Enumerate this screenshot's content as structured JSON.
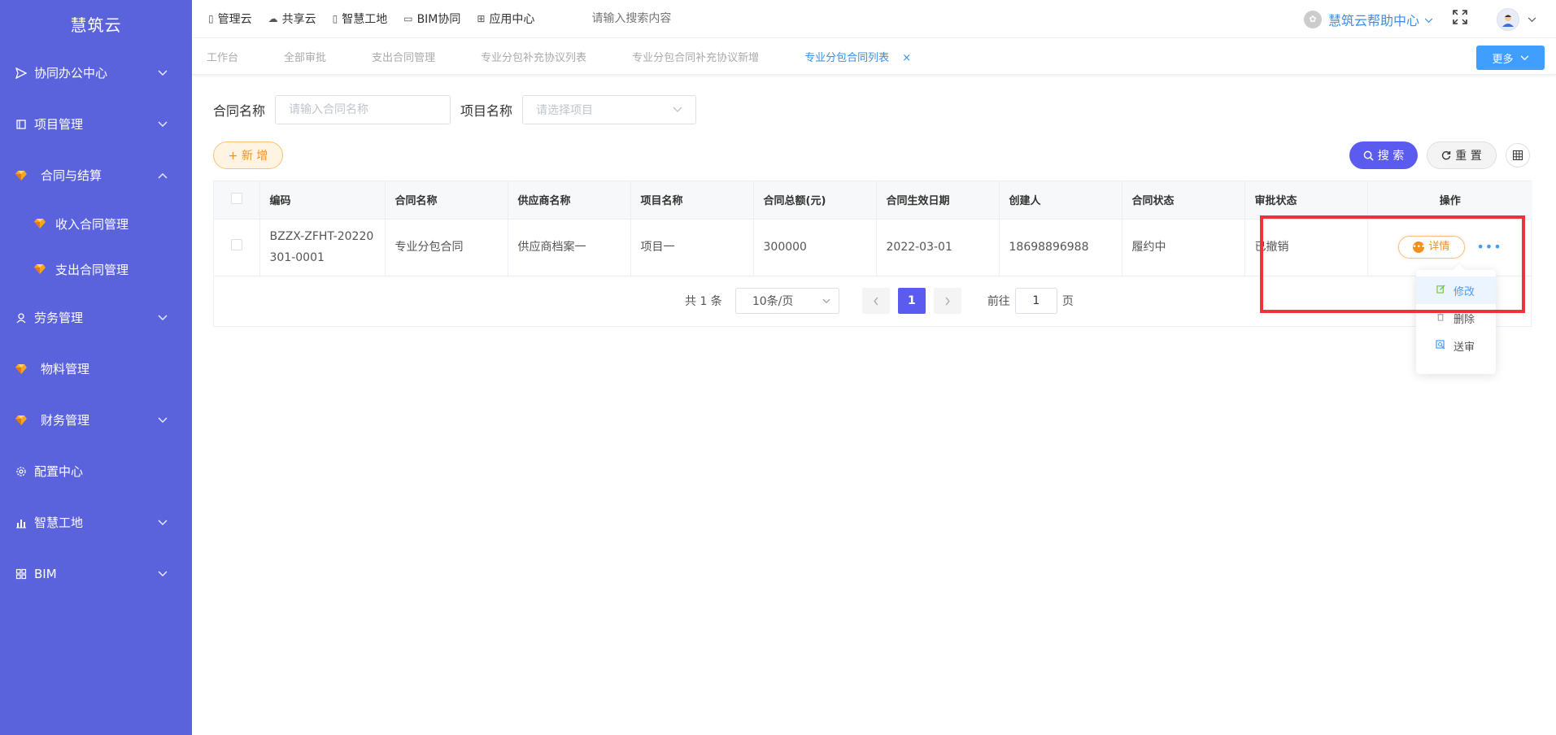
{
  "app": {
    "logo": "慧筑云"
  },
  "sidebar": {
    "items": [
      {
        "label": "协同办公中心",
        "icon": "send-icon",
        "chevron": "down"
      },
      {
        "label": "项目管理",
        "icon": "book-icon",
        "chevron": "down"
      },
      {
        "label": "合同与结算",
        "icon": "gem-icon",
        "chevron": "up"
      },
      {
        "label": "收入合同管理",
        "icon": "gem-icon"
      },
      {
        "label": "支出合同管理",
        "icon": "gem-icon"
      },
      {
        "label": "劳务管理",
        "icon": "worker-icon",
        "chevron": "down"
      },
      {
        "label": "物料管理",
        "icon": "gem-icon"
      },
      {
        "label": "财务管理",
        "icon": "gem-icon",
        "chevron": "down"
      },
      {
        "label": "配置中心",
        "icon": "gear-icon"
      },
      {
        "label": "智慧工地",
        "icon": "bar-chart-icon",
        "chevron": "down"
      },
      {
        "label": "BIM",
        "icon": "grid-icon",
        "chevron": "down"
      }
    ]
  },
  "topnav": {
    "items": [
      {
        "label": "管理云",
        "icon": "doc-icon"
      },
      {
        "label": "共享云",
        "icon": "cloud-icon"
      },
      {
        "label": "智慧工地",
        "icon": "doc-icon"
      },
      {
        "label": "BIM协同",
        "icon": "folder-icon"
      },
      {
        "label": "应用中心",
        "icon": "apps-icon"
      }
    ],
    "search_placeholder": "请输入搜索内容",
    "help_label": "慧筑云帮助中心"
  },
  "tabs": {
    "items": [
      {
        "label": "工作台"
      },
      {
        "label": "全部审批"
      },
      {
        "label": "支出合同管理"
      },
      {
        "label": "专业分包补充协议列表"
      },
      {
        "label": "专业分包合同补充协议新增"
      },
      {
        "label": "专业分包合同列表",
        "active": true
      }
    ],
    "close_glyph": "×",
    "more_label": "更多"
  },
  "filter": {
    "contract_name_label": "合同名称",
    "contract_name_placeholder": "请输入合同名称",
    "project_name_label": "项目名称",
    "project_name_placeholder": "请选择项目"
  },
  "actions": {
    "add_label": "+ 新 增",
    "search_label": "搜 索",
    "reset_label": "重 置"
  },
  "table": {
    "columns": [
      "编码",
      "合同名称",
      "供应商名称",
      "项目名称",
      "合同总额(元)",
      "合同生效日期",
      "创建人",
      "合同状态",
      "审批状态",
      "操作"
    ],
    "rows": [
      {
        "code": "BZZX-ZFHT-20220301-0001",
        "contract_name": "专业分包合同",
        "supplier": "供应商档案一",
        "project": "项目一",
        "amount": "300000",
        "effective_date": "2022-03-01",
        "creator": "18698896988",
        "contract_status": "履约中",
        "approval_status": "已撤销",
        "detail_label": "详情",
        "more_glyph": "•••"
      }
    ]
  },
  "pagination": {
    "total_text": "共 1 条",
    "page_size": "10条/页",
    "current_page": "1",
    "goto_label": "前往",
    "goto_value": "1",
    "page_unit": "页"
  },
  "dropdown": {
    "items": [
      {
        "label": "修改",
        "icon": "edit-icon"
      },
      {
        "label": "删除",
        "icon": "trash-icon"
      },
      {
        "label": "送审",
        "icon": "submit-icon"
      }
    ]
  },
  "colors": {
    "sidebar_bg": "#5b63dc",
    "accent": "#409eff",
    "primary_button": "#5b5bf0",
    "add_button": "#f0901e",
    "highlight": "#e8343a"
  }
}
